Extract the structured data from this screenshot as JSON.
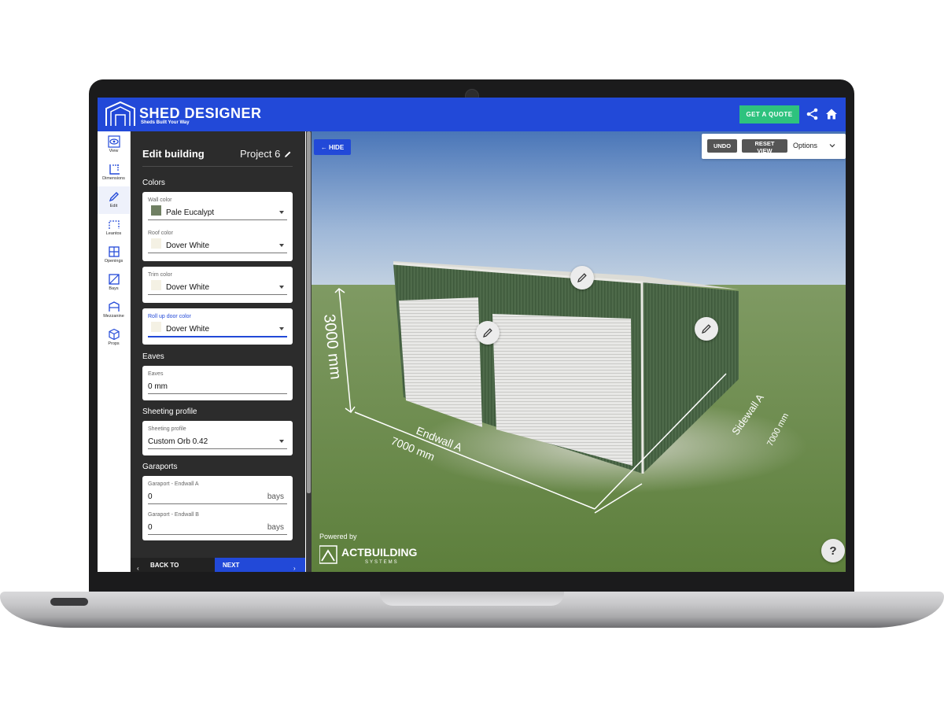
{
  "header": {
    "brand_title": "SHED DESIGNER",
    "brand_subtitle": "Sheds Built Your Way",
    "quote_button": "GET A QUOTE",
    "share_icon": "share-icon",
    "home_icon": "home-icon",
    "color": "#2249d8"
  },
  "rail": {
    "items": [
      {
        "label": "View",
        "icon": "eye-icon"
      },
      {
        "label": "Dimensions",
        "icon": "dimensions-icon"
      },
      {
        "label": "Edit",
        "icon": "pencil-icon"
      },
      {
        "label": "Leantos",
        "icon": "leanto-icon"
      },
      {
        "label": "Openings",
        "icon": "openings-icon"
      },
      {
        "label": "Bays",
        "icon": "bays-icon"
      },
      {
        "label": "Mezzanine",
        "icon": "mezzanine-icon"
      },
      {
        "label": "Props",
        "icon": "cube-icon"
      }
    ],
    "active": "Edit"
  },
  "panel": {
    "title": "Edit building",
    "project_name": "Project 6",
    "colors_section": "Colors",
    "wall_color_label": "Wall color",
    "wall_color_value": "Pale Eucalypt",
    "wall_color_hex": "#6f7f62",
    "roof_color_label": "Roof color",
    "roof_color_value": "Dover White",
    "trim_color_label": "Trim color",
    "trim_color_value": "Dover White",
    "door_color_label": "Roll up door color",
    "door_color_value": "Dover White",
    "dover_white_hex": "#f4f1e4",
    "eaves_section": "Eaves",
    "eaves_label": "Eaves",
    "eaves_value": "0 mm",
    "sheeting_section": "Sheeting profile",
    "sheeting_label": "Sheeting profile",
    "sheeting_value": "Custom Orb 0.42",
    "garaports_section": "Garaports",
    "garaport_a_label": "Garaport - Endwall A",
    "garaport_a_value": "0",
    "garaport_b_label": "Garaport - Endwall B",
    "garaport_b_value": "0",
    "bays_unit": "bays",
    "back_button": "BACK TO",
    "next_button": "NEXT"
  },
  "viewport": {
    "hide_button": "← HIDE",
    "undo_button": "UNDO",
    "reset_button": "RESET VIEW",
    "options_label": "Options",
    "height_dim": "3000 mm",
    "endwall_label": "Endwall A",
    "endwall_dim": "7000 mm",
    "sidewall_label": "Sidewall A",
    "sidewall_dim": "7000 mm",
    "powered_by": "Powered by",
    "act_brand": "ACTBUILDING",
    "act_sub": "SYSTEMS",
    "help_button": "?"
  }
}
